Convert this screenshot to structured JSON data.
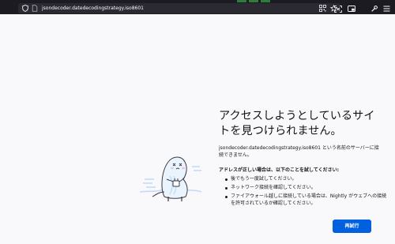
{
  "browser": {
    "url_host": "jsondecoder.",
    "url_rest": "datedecodingstrategy.iso8601",
    "icons": {
      "shield": "shield-icon",
      "page": "page-icon",
      "qr": "qr-code-icon",
      "bookmark": "star-icon",
      "screenshot": "screenshot-icon",
      "picture_in_picture": "picture-in-picture-icon",
      "tools": "wrench-icon",
      "menu": "hamburger-menu-icon"
    }
  },
  "error_page": {
    "title": "アクセスしようとしているサイトを見つけられません。",
    "lead": "jsondecoder.datedecodingstrategy.iso8601 という名前のサーバーに接続できません。",
    "advice_heading": "アドレスが正しい場合は、以下のことを試してください:",
    "advice_items": [
      "後でもう一度試してください。",
      "ネットワーク接続を確認してください。",
      "ファイアウォール越しに接続している場合は、Nightly がウェブへの接続を許可されているか確認してください。"
    ],
    "retry_label": "再試行",
    "illustration": "broken-connection-dinosaur-illustration"
  },
  "colors": {
    "accent": "#0061e0",
    "toolbar": "#1c1b22",
    "urlbar": "#2b2a33",
    "page_bg": "#f9f9fb"
  }
}
